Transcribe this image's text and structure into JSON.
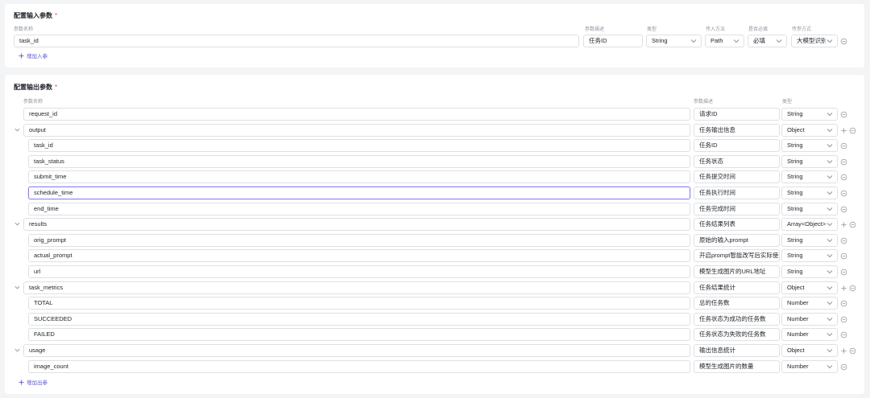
{
  "input_section": {
    "title": "配置输入参数",
    "required_mark": "*",
    "headers": {
      "name": "参数名称",
      "desc": "参数描述",
      "type": "类型",
      "method": "传入方法",
      "required": "是否必填",
      "pass": "传参方式"
    },
    "rows": [
      {
        "name": "task_id",
        "desc": "任务ID",
        "type": "String",
        "method": "Path",
        "required": "必填",
        "pass": "大模型识别"
      }
    ],
    "add_label": "增加入参"
  },
  "output_section": {
    "title": "配置输出参数",
    "required_mark": "*",
    "headers": {
      "name": "参数名称",
      "desc": "参数描述",
      "type": "类型"
    },
    "rows": [
      {
        "name": "request_id",
        "desc": "请求ID",
        "type": "String",
        "level": 0,
        "expandable": false
      },
      {
        "name": "output",
        "desc": "任务输出信息",
        "type": "Object",
        "level": 0,
        "expandable": true
      },
      {
        "name": "task_id",
        "desc": "任务ID",
        "type": "String",
        "level": 1,
        "expandable": false
      },
      {
        "name": "task_status",
        "desc": "任务状态",
        "type": "String",
        "level": 1,
        "expandable": false
      },
      {
        "name": "submit_time",
        "desc": "任务提交时间",
        "type": "String",
        "level": 1,
        "expandable": false
      },
      {
        "name": "schedule_time",
        "desc": "任务执行时间",
        "type": "String",
        "level": 1,
        "expandable": false,
        "focused": true
      },
      {
        "name": "end_time",
        "desc": "任务完成时间",
        "type": "String",
        "level": 1,
        "expandable": false
      },
      {
        "name": "results",
        "desc": "任务结果列表",
        "type": "Array<Object>",
        "level": 0,
        "expandable": true
      },
      {
        "name": "orig_prompt",
        "desc": "原始的输入prompt",
        "type": "String",
        "level": 1,
        "expandable": false
      },
      {
        "name": "actual_prompt",
        "desc": "开启prompt智能改写后实际使F",
        "type": "String",
        "level": 1,
        "expandable": false
      },
      {
        "name": "url",
        "desc": "模型生成图片的URL地址",
        "type": "String",
        "level": 1,
        "expandable": false
      },
      {
        "name": "task_metrics",
        "desc": "任务结果统计",
        "type": "Object",
        "level": 0,
        "expandable": true
      },
      {
        "name": "TOTAL",
        "desc": "总的任务数",
        "type": "Number",
        "level": 1,
        "expandable": false
      },
      {
        "name": "SUCCEEDED",
        "desc": "任务状态为成功的任务数",
        "type": "Number",
        "level": 1,
        "expandable": false
      },
      {
        "name": "FAILED",
        "desc": "任务状态为失败的任务数",
        "type": "Number",
        "level": 1,
        "expandable": false
      },
      {
        "name": "usage",
        "desc": "输出信息统计",
        "type": "Object",
        "level": 0,
        "expandable": true
      },
      {
        "name": "image_count",
        "desc": "模型生成图片的数量",
        "type": "Number",
        "level": 1,
        "expandable": false
      }
    ],
    "add_label": "增加出参"
  },
  "colors": {
    "accent": "#5b56d6",
    "focus_border": "#8a86ef",
    "required": "#f54a45",
    "border": "#dee0e3",
    "icon": "#8f959e"
  },
  "icons": {
    "expand": "chevron-down-icon",
    "add": "plus-icon",
    "remove": "minus-circle-icon"
  }
}
